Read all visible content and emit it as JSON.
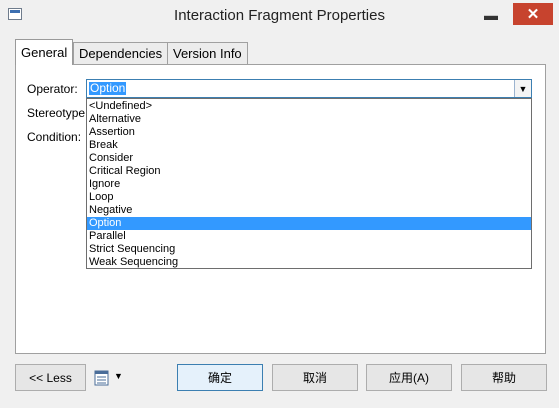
{
  "window": {
    "title": "Interaction Fragment Properties",
    "minimize_glyph": "▬",
    "close_glyph": "✕",
    "app_icon": "window-icon"
  },
  "tabs": [
    {
      "label": "General",
      "active": true
    },
    {
      "label": "Dependencies",
      "active": false
    },
    {
      "label": "Version Info",
      "active": false
    }
  ],
  "form": {
    "operator_label": "Operator:",
    "stereotype_label": "Stereotype:",
    "condition_label": "Condition:",
    "operator_value": "Option",
    "arrow_glyph": "▼"
  },
  "dropdown": {
    "items": [
      "<Undefined>",
      "Alternative",
      "Assertion",
      "Break",
      "Consider",
      "Critical Region",
      "Ignore",
      "Loop",
      "Negative",
      "Option",
      "Parallel",
      "Strict Sequencing",
      "Weak Sequencing"
    ],
    "selected": "Option"
  },
  "buttons": {
    "less": "<< Less",
    "menu_arrow": "▼",
    "ok": "确定",
    "cancel": "取消",
    "apply": "应用(A)",
    "help": "帮助"
  },
  "colors": {
    "selection": "#3399ff",
    "close": "#c7432e",
    "accent": "#3c7fb1"
  }
}
